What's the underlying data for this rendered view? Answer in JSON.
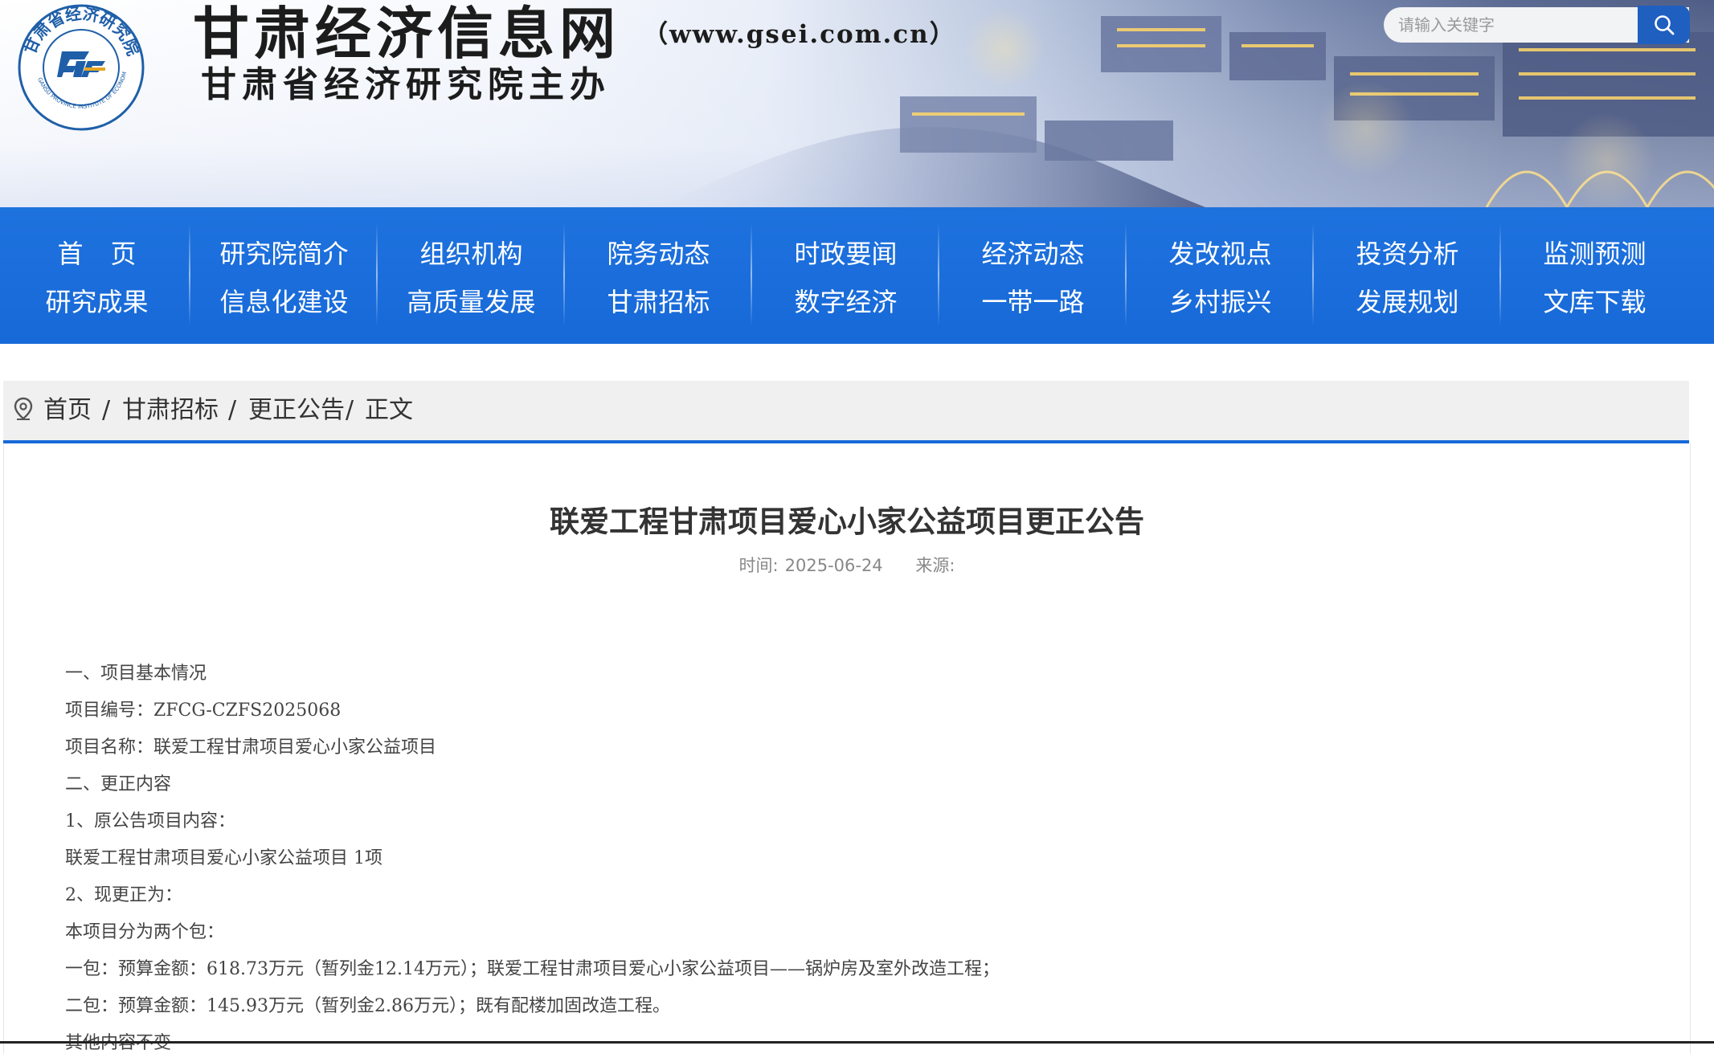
{
  "header": {
    "site_title": "甘肃经济信息网",
    "site_url": "（www.gsei.com.cn）",
    "site_subtitle": "甘肃省经济研究院主办",
    "logo_ring_text": "甘肃省经济研究院",
    "logo_ring_text_en": "GANSU PROVINCE INSTITUTE OF ECONOMIC RESEARCH",
    "search_placeholder": "请输入关键字"
  },
  "nav": {
    "columns": [
      {
        "top": "首页",
        "bottom": "研究成果"
      },
      {
        "top": "研究院简介",
        "bottom": "信息化建设"
      },
      {
        "top": "组织机构",
        "bottom": "高质量发展"
      },
      {
        "top": "院务动态",
        "bottom": "甘肃招标"
      },
      {
        "top": "时政要闻",
        "bottom": "数字经济"
      },
      {
        "top": "经济动态",
        "bottom": "一带一路"
      },
      {
        "top": "发改视点",
        "bottom": "乡村振兴"
      },
      {
        "top": "投资分析",
        "bottom": "发展规划"
      },
      {
        "top": "监测预测",
        "bottom": "文库下载"
      }
    ]
  },
  "breadcrumb": {
    "home": "首页",
    "sep1": "/",
    "section": "甘肃招标",
    "sep2": "/",
    "category": "更正公告",
    "sep3": "/",
    "current": "正文"
  },
  "article": {
    "title": "联爱工程甘肃项目爱心小家公益项目更正公告",
    "time_label": "时间:",
    "date": "2025-06-24",
    "source_label": "来源:",
    "lines": [
      "一、项目基本情况",
      "项目编号：ZFCG-CZFS2025068",
      "项目名称：联爱工程甘肃项目爱心小家公益项目",
      "二、更正内容",
      "1、原公告项目内容：",
      "联爱工程甘肃项目爱心小家公益项目 1项",
      "2、现更正为：",
      "本项目分为两个包：",
      "一包：预算金额：618.73万元（暂列金12.14万元）；联爱工程甘肃项目爱心小家公益项目——锅炉房及室外改造工程；",
      "二包：预算金额：145.93万元（暂列金2.86万元）；既有配楼加固改造工程。",
      "其他内容不变"
    ]
  },
  "colors": {
    "nav_bg": "#1769d8",
    "search_button": "#1f5fc0",
    "breadcrumb_underline": "#1769d8",
    "logo_blue": "#1f5fa8"
  },
  "icons": {
    "search": "magnifier-icon",
    "breadcrumb": "location-pin-icon"
  }
}
